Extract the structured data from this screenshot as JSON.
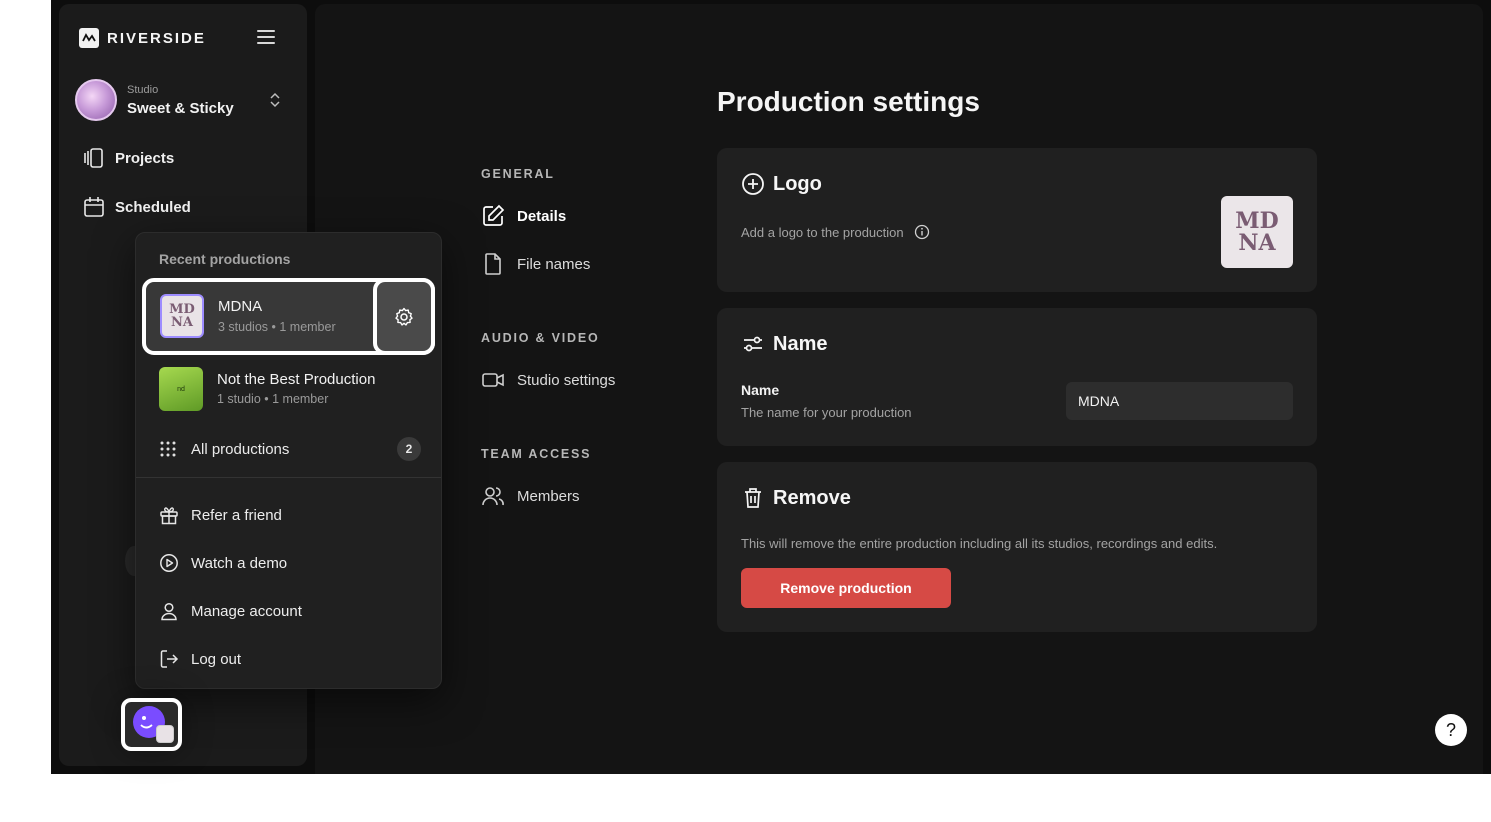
{
  "brand": {
    "name": "RIVERSIDE"
  },
  "studio": {
    "kicker": "Studio",
    "name": "Sweet & Sticky"
  },
  "nav": {
    "projects": "Projects",
    "scheduled": "Scheduled"
  },
  "recent": {
    "title": "Recent productions",
    "items": [
      {
        "name": "MDNA",
        "meta": "3 studios • 1 member",
        "thumb_text": "MD NA"
      },
      {
        "name": "Not the Best Production",
        "meta": "1 studio • 1 member",
        "thumb_text": "nd"
      }
    ],
    "all_label": "All productions",
    "all_count": "2"
  },
  "account_menu": [
    "Refer a friend",
    "Watch a demo",
    "Manage account",
    "Log out"
  ],
  "page": {
    "title": "Production settings"
  },
  "settings_nav": {
    "sections": [
      {
        "label": "GENERAL",
        "items": [
          "Details",
          "File names"
        ]
      },
      {
        "label": "AUDIO & VIDEO",
        "items": [
          "Studio settings"
        ]
      },
      {
        "label": "TEAM ACCESS",
        "items": [
          "Members"
        ]
      }
    ]
  },
  "logo_card": {
    "title": "Logo",
    "desc": "Add a logo to the production",
    "thumb_text": "MD NA"
  },
  "name_card": {
    "title": "Name",
    "field_label": "Name",
    "field_help": "The name for your production",
    "value": "MDNA"
  },
  "remove_card": {
    "title": "Remove",
    "desc": "This will remove the entire production including all its studios, recordings and edits.",
    "button": "Remove production"
  },
  "help": {
    "label": "?"
  },
  "colors": {
    "accent_danger": "#d64a45",
    "app_bg": "#0d0d0d",
    "card_bg": "#202020"
  }
}
